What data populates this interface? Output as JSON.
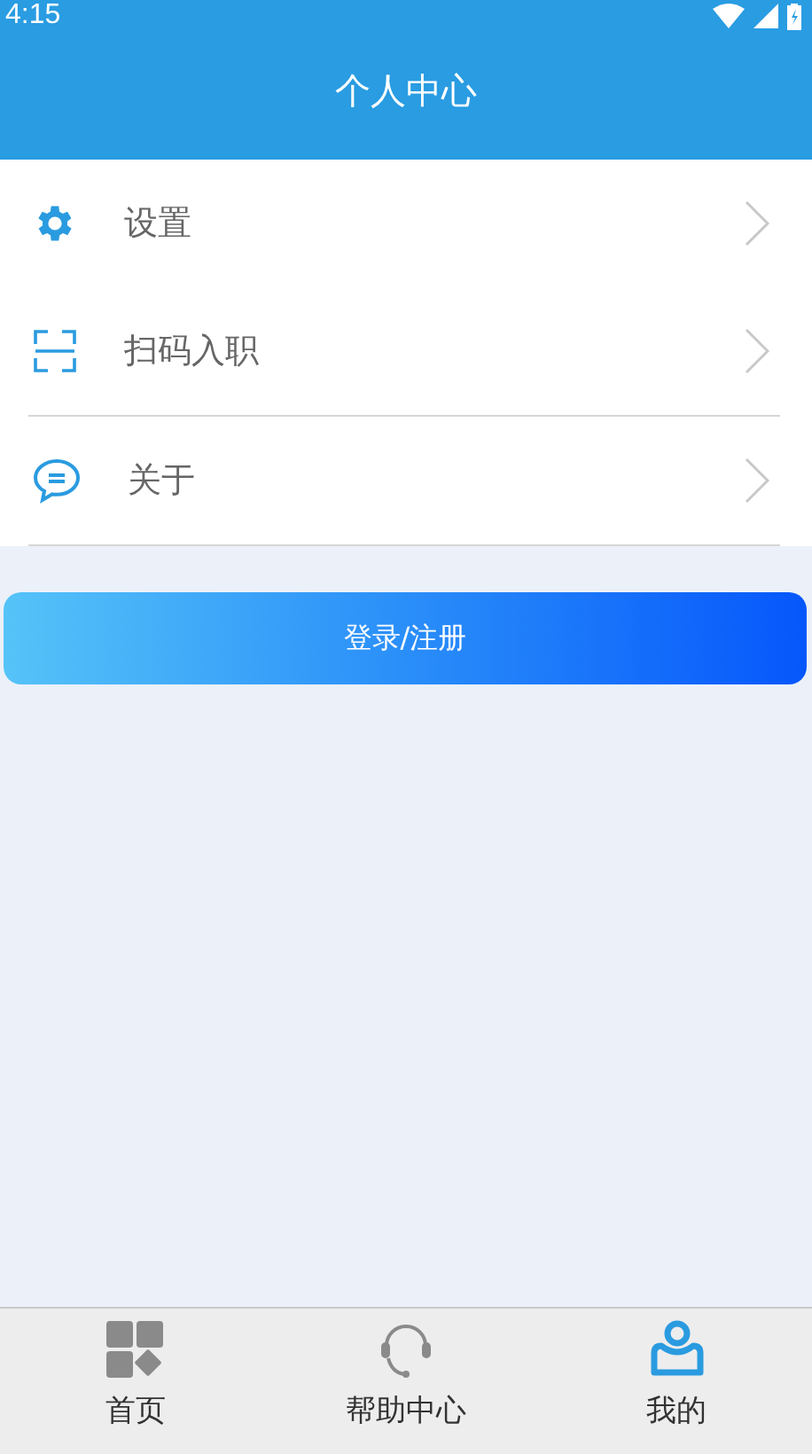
{
  "status_bar": {
    "time": "4:15"
  },
  "header": {
    "title": "个人中心"
  },
  "menu": [
    {
      "kind": "settings",
      "label": "设置",
      "divider": false
    },
    {
      "kind": "scan",
      "label": "扫码入职",
      "divider": true
    },
    {
      "kind": "about",
      "label": "关于",
      "divider": true
    }
  ],
  "login_button": {
    "label": "登录/注册"
  },
  "tabs": [
    {
      "kind": "home",
      "label": "首页",
      "selected": false
    },
    {
      "kind": "help",
      "label": "帮助中心",
      "selected": false
    },
    {
      "kind": "me",
      "label": "我的",
      "selected": true
    }
  ]
}
